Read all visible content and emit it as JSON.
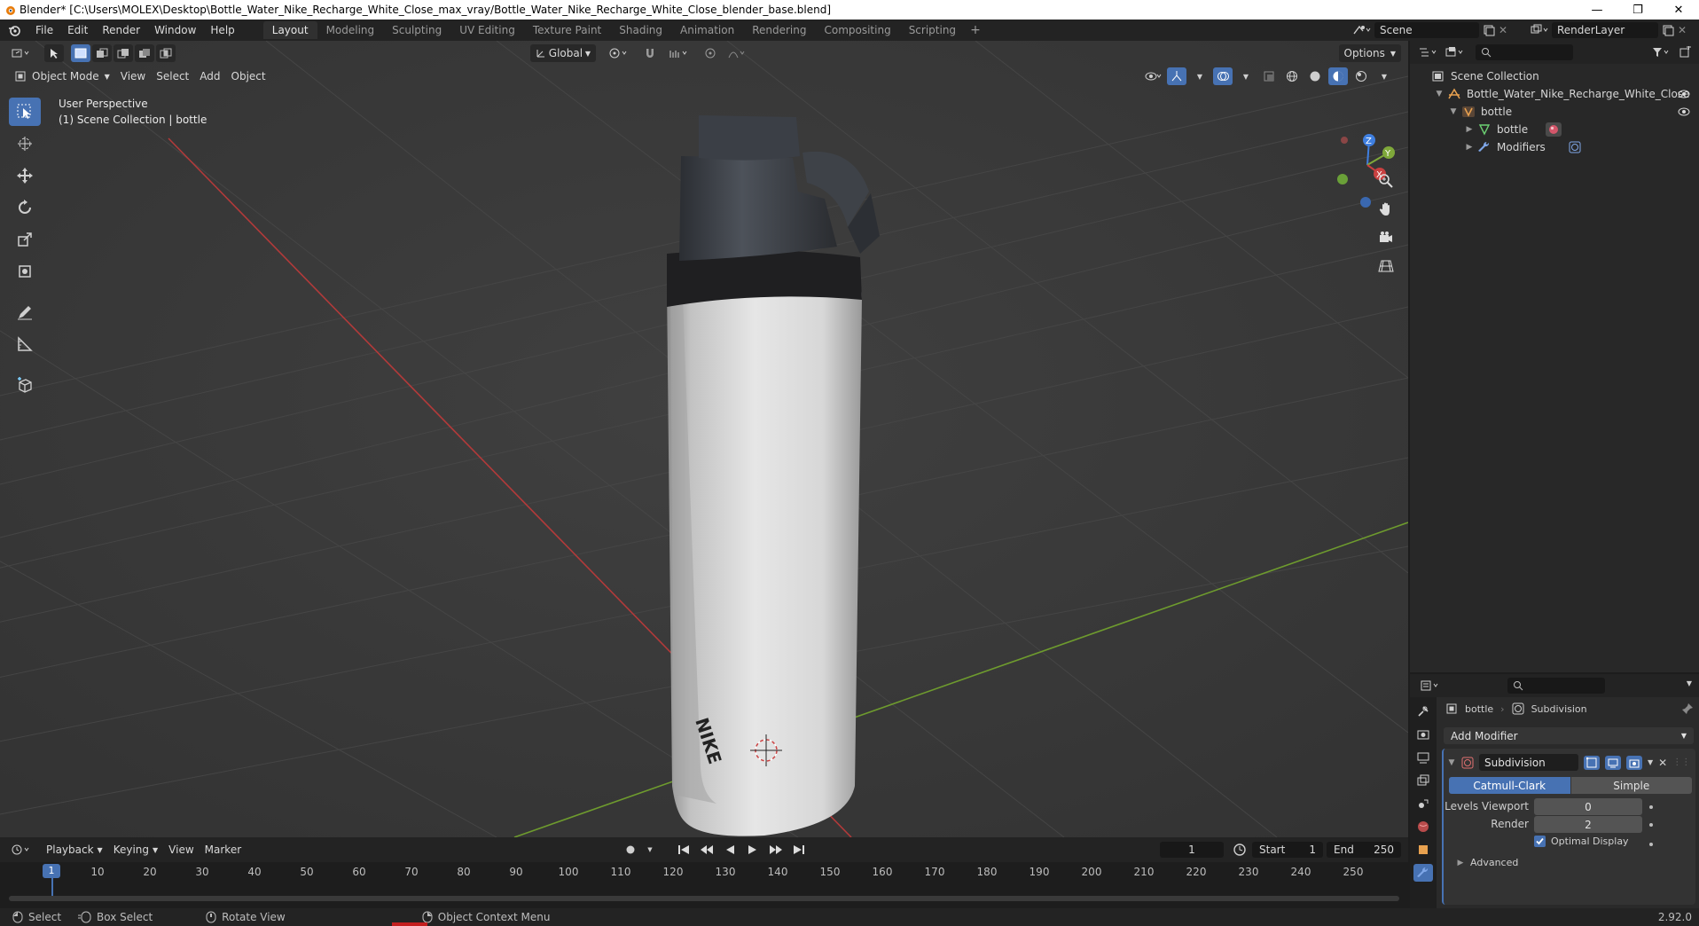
{
  "window": {
    "title": "Blender* [C:\\Users\\MOLEX\\Desktop\\Bottle_Water_Nike_Recharge_White_Close_max_vray/Bottle_Water_Nike_Recharge_White_Close_blender_base.blend]"
  },
  "menu": [
    "File",
    "Edit",
    "Render",
    "Window",
    "Help"
  ],
  "workspaces": [
    {
      "label": "Layout",
      "active": true
    },
    {
      "label": "Modeling"
    },
    {
      "label": "Sculpting"
    },
    {
      "label": "UV Editing"
    },
    {
      "label": "Texture Paint"
    },
    {
      "label": "Shading"
    },
    {
      "label": "Animation"
    },
    {
      "label": "Rendering"
    },
    {
      "label": "Compositing"
    },
    {
      "label": "Scripting"
    }
  ],
  "topbar": {
    "scene": "Scene",
    "render_layer": "RenderLayer"
  },
  "viewport": {
    "transform_orientation": "Global",
    "options_label": "Options",
    "mode": "Object Mode",
    "header_menus": [
      "View",
      "Select",
      "Add",
      "Object"
    ],
    "info_line1": "User Perspective",
    "info_line2": "(1) Scene Collection | bottle",
    "gizmo": {
      "z": "Z",
      "y": "Y",
      "x": "X"
    },
    "brand_text": "NIKE"
  },
  "timeline": {
    "menus": [
      "Playback",
      "Keying",
      "View",
      "Marker"
    ],
    "current_frame": "1",
    "start_label": "Start",
    "start": "1",
    "end_label": "End",
    "end": "250",
    "ticks": [
      "10",
      "20",
      "30",
      "40",
      "50",
      "60",
      "70",
      "80",
      "90",
      "100",
      "110",
      "120",
      "130",
      "140",
      "150",
      "160",
      "170",
      "180",
      "190",
      "200",
      "210",
      "220",
      "230",
      "240",
      "250"
    ],
    "badge": "1"
  },
  "status": {
    "select": "Select",
    "box_select": "Box Select",
    "rotate_view": "Rotate View",
    "context_menu": "Object Context Menu",
    "version": "2.92.0"
  },
  "outliner": {
    "root": "Scene Collection",
    "collection": "Bottle_Water_Nike_Recharge_White_Close",
    "object": "bottle",
    "mesh": "bottle",
    "modifiers": "Modifiers"
  },
  "properties": {
    "object_name": "bottle",
    "modifier_name_crumb": "Subdivision",
    "add_modifier": "Add Modifier",
    "modifier_name": "Subdivision",
    "catmull_clark": "Catmull-Clark",
    "simple": "Simple",
    "levels_viewport_label": "Levels Viewport",
    "levels_viewport": "0",
    "render_label": "Render",
    "render": "2",
    "optimal_display": "Optimal Display",
    "advanced": "Advanced"
  },
  "colors": {
    "accent": "#4772b3",
    "x_axis": "#c94040",
    "y_axis": "#7fa83a",
    "z_axis": "#3f7fe0"
  }
}
